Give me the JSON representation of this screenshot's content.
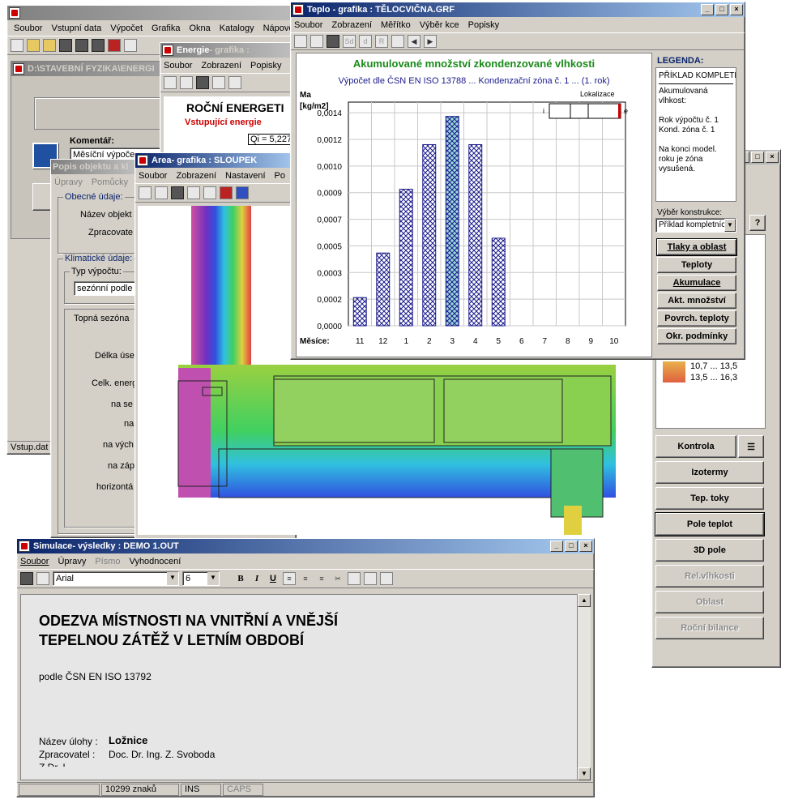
{
  "main": {
    "menu": [
      "Soubor",
      "Vstupní data",
      "Výpočet",
      "Grafika",
      "Okna",
      "Katalogy",
      "Nápově"
    ],
    "child_title": "D:\\STAVEBNÍ FYZIKA\\ENERGI",
    "dialog_heading": "DE",
    "comment_label": "Komentář:",
    "comment_value": "Měsíční výpoče",
    "status": "Vstup.dat"
  },
  "popis": {
    "title": "Popis objektu a kl",
    "menu": [
      "Úpravy",
      "Pomůcky"
    ],
    "general_group": "Obecné údaje:",
    "name_label": "Název objekt",
    "author_label": "Zpracovate",
    "climate_group": "Klimatické údaje:",
    "calc_type_group": "Typ výpočtu:",
    "calc_type_value": "sezónní podle",
    "season_label": "Topná sezóna",
    "fields": [
      "Délka úse",
      "Celk. energ",
      "na se",
      "na",
      "na vých",
      "na záp",
      "horizontá"
    ]
  },
  "energie": {
    "title": "Energie",
    "title_rest": " - grafika : ",
    "menu": [
      "Soubor",
      "Zobrazení",
      "Popisky"
    ],
    "heading": "ROČNÍ ENERGETI",
    "subheading": "Vstupující energie",
    "qi": "Qi = 5,227"
  },
  "area": {
    "title": "Area",
    "title_rest": " - grafika : SLOUPEK",
    "menu": [
      "Soubor",
      "Zobrazení",
      "Nastavení",
      "Po"
    ]
  },
  "teplo": {
    "title": "Teplo - grafika : TĚLOCVIČNA.GRF",
    "menu": [
      "Soubor",
      "Zobrazení",
      "Měřítko",
      "Výběr kce",
      "Popisky"
    ],
    "legend_title": "LEGENDA:",
    "legend_lines": [
      "PŘÍKLAD KOMPLETN",
      "Akumulovaná",
      "vlhkost:",
      "Rok výpočtu č. 1",
      "Kond. zóna č. 1",
      "Na konci model.",
      "roku je zóna",
      "vysušená."
    ],
    "select_label": "Výběr konstrukce:",
    "select_value": "Příklad kompletních",
    "buttons": [
      "Tlaky a oblast",
      "Teploty",
      "Akumulace",
      "Akt. množství",
      "Povrch. teploty",
      "Okr. podmínky"
    ],
    "lokalizace": "Lokalizace",
    "loc_left": "i",
    "loc_right": "e"
  },
  "chart_data": {
    "type": "bar",
    "title": "Akumulované množství zkondenzované vlhkosti",
    "subtitle": "Výpočet dle ČSN EN ISO 13788 ... Kondenzační zóna č. 1 ... (1. rok)",
    "ylabel": "Ma\n[kg/m2]",
    "xlabel": "Měsíce:",
    "categories": [
      "11",
      "12",
      "1",
      "2",
      "3",
      "4",
      "5",
      "6",
      "7",
      "8",
      "9",
      "10"
    ],
    "values": [
      0.00019,
      0.00049,
      0.00092,
      0.00122,
      0.00141,
      0.00122,
      0.00059,
      0,
      0,
      0,
      0,
      0
    ],
    "yticks": [
      "0,0000",
      "0,0002",
      "0,0003",
      "0,0005",
      "0,0007",
      "0,0009",
      "0,0010",
      "0,0012",
      "0,0014"
    ],
    "ylim": [
      0,
      0.00155
    ],
    "grid": true,
    "color": "#1a1a8c"
  },
  "area_side": {
    "legend_values": [
      "10,7 ... 13,5",
      "13,5 ... 16,3"
    ],
    "legend_colors": [
      "#e8b04c",
      "#e06040"
    ],
    "buttons": [
      "Kontrola",
      "Izotermy",
      "Tep. toky",
      "Pole teplot",
      "3D pole",
      "Rel.vlhkosti",
      "Oblast",
      "Roční bilance"
    ]
  },
  "simulace": {
    "title": "Simulace",
    "title_rest": " - výsledky : DEMO 1.OUT",
    "menu": [
      "Soubor",
      "Úpravy",
      "Písmo",
      "Vyhodnocení"
    ],
    "font": "Arial",
    "size": "6",
    "heading1": "ODEZVA MÍSTNOSTI NA VNITŘNÍ A VNĚJŠÍ",
    "heading2": "TEPELNOU ZÁTĚŽ V LETNÍM OBDOBÍ",
    "norm": "podle ČSN EN ISO 13792",
    "task_label": "Název úlohy :",
    "task_value": "Ložnice",
    "author_label": "Zpracovatel :",
    "author_value": "Doc. Dr. Ing. Z. Svoboda",
    "cut": "Z    Dr. I...",
    "status_chars": "10299 znaků",
    "status_ins": "INS",
    "status_caps": "CAPS"
  }
}
